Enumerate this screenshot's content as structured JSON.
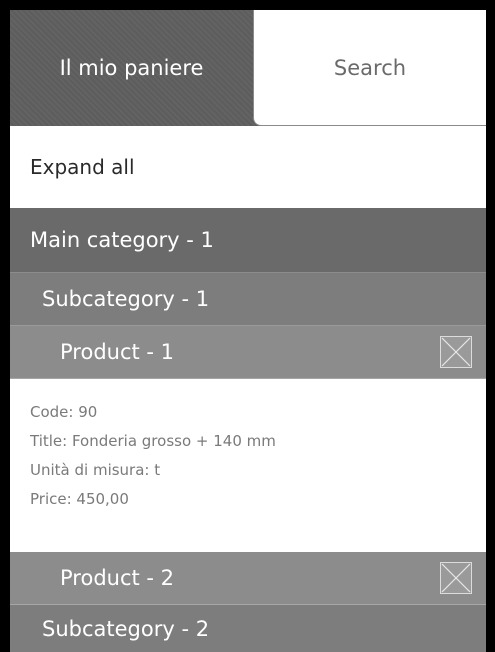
{
  "tabs": {
    "basket": "Il mio paniere",
    "search": "Search"
  },
  "expand_all": "Expand all",
  "main_category": "Main category - 1",
  "subcategories": [
    {
      "label": "Subcategory - 1"
    },
    {
      "label": "Subcategory - 2"
    }
  ],
  "products": [
    {
      "label": "Product - 1",
      "details": {
        "code": "Code: 90",
        "title": "Title: Fonderia grosso + 140 mm",
        "unit": "Unità di misura: t",
        "price": "Price: 450,00"
      }
    },
    {
      "label": "Product - 2"
    }
  ],
  "icons": {
    "remove": "close-icon"
  },
  "colors": {
    "active_tab": "#5f5f5f",
    "main_category": "#6a6a6a",
    "subcategory": "#7d7d7d",
    "product": "#8c8c8c"
  }
}
